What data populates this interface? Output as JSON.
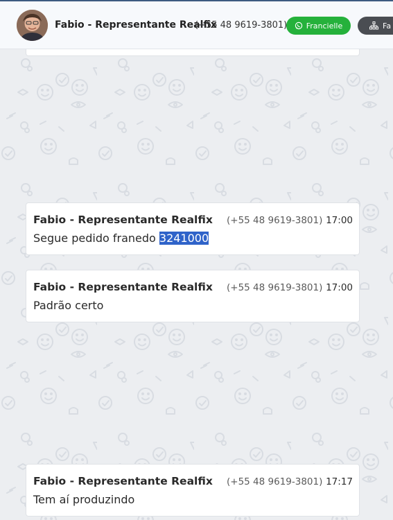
{
  "header": {
    "contact_name": "Fabio - Representante Realfix",
    "contact_phone": "(+55 48 9619-3801)",
    "whatsapp_button_label": "Francielle",
    "whatsapp_icon": "whatsapp-icon",
    "second_button_label": "Fa",
    "second_button_icon": "sitemap-icon"
  },
  "messages": [
    {
      "sender": "Fabio - Representante Realfix",
      "phone": "(+55 48 9619-3801)",
      "time": "17:00",
      "text": "Segue pedido franedo ",
      "highlighted_text": "3241000"
    },
    {
      "sender": "Fabio - Representante Realfix",
      "phone": "(+55 48 9619-3801)",
      "time": "17:00",
      "text": "Padrão certo"
    },
    {
      "sender": "Fabio - Representante Realfix",
      "phone": "(+55 48 9619-3801)",
      "time": "17:17",
      "text": "Tem aí produzindo"
    }
  ],
  "colors": {
    "header_bg": "#f7f9fc",
    "chat_bg": "#eceef1",
    "whatsapp_green": "#25b13b",
    "dark_button": "#4a4d52",
    "selection_highlight": "#2f63c9"
  }
}
